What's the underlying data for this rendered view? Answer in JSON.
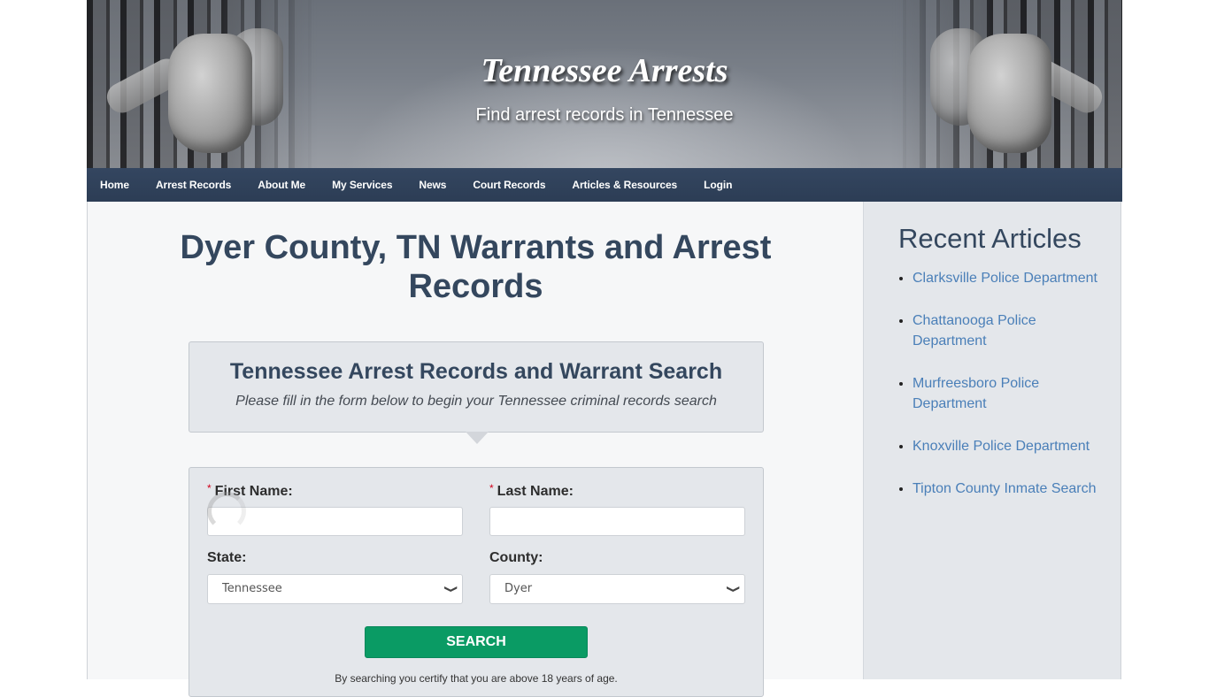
{
  "header": {
    "site_title": "Tennessee Arrests",
    "tagline": "Find arrest records in Tennessee"
  },
  "nav": {
    "items": [
      {
        "label": "Home"
      },
      {
        "label": "Arrest Records"
      },
      {
        "label": "About Me"
      },
      {
        "label": "My Services"
      },
      {
        "label": "News"
      },
      {
        "label": "Court Records"
      },
      {
        "label": "Articles & Resources"
      },
      {
        "label": "Login"
      }
    ]
  },
  "main": {
    "page_title": "Dyer County, TN Warrants and Arrest Records",
    "intro": {
      "title": "Tennessee Arrest Records and Warrant Search",
      "subtitle": "Please fill in the form below to begin your Tennessee criminal records search"
    },
    "form": {
      "required_marker": "*",
      "first_name": {
        "label": "First Name:",
        "value": ""
      },
      "last_name": {
        "label": "Last Name:",
        "value": ""
      },
      "state": {
        "label": "State:",
        "selected": "Tennessee"
      },
      "county": {
        "label": "County:",
        "selected": "Dyer"
      },
      "search_label": "SEARCH",
      "disclaimer": "By searching you certify that you are above 18 years of age."
    }
  },
  "sidebar": {
    "title": "Recent Articles",
    "articles": [
      {
        "label": "Clarksville Police Department"
      },
      {
        "label": "Chattanooga Police Department"
      },
      {
        "label": "Murfreesboro Police Department"
      },
      {
        "label": "Knoxville Police Department"
      },
      {
        "label": "Tipton County Inmate Search"
      }
    ]
  },
  "colors": {
    "nav_bg": "#2f4058",
    "heading": "#34475e",
    "link": "#4a7fb8",
    "search_button": "#0a9b64",
    "required": "#d0021b",
    "panel_bg": "#e4e7eb",
    "main_bg": "#f6f7f8"
  },
  "icons": {
    "select_chevron": "chevron-down-icon",
    "list_bullet": "bullet-icon",
    "loading": "loading-spinner-icon"
  }
}
